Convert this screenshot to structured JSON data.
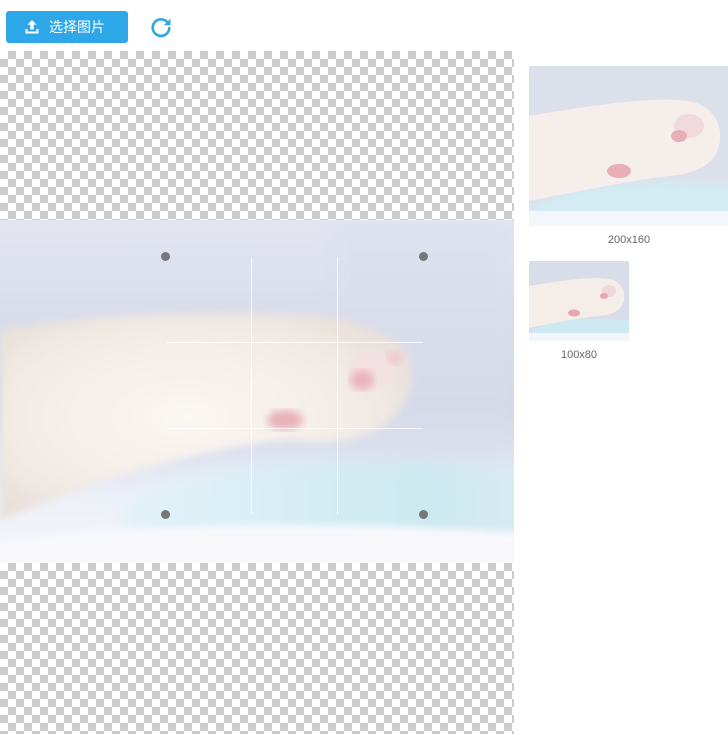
{
  "toolbar": {
    "upload_label": "选择图片",
    "upload_icon": "upload-icon",
    "rotate_icon": "rotate-icon",
    "accent_color": "#2ea7e8"
  },
  "cropper": {
    "image_description": "cat-paw-photo"
  },
  "previews": [
    {
      "label": "200x160"
    },
    {
      "label": "100x80"
    }
  ]
}
